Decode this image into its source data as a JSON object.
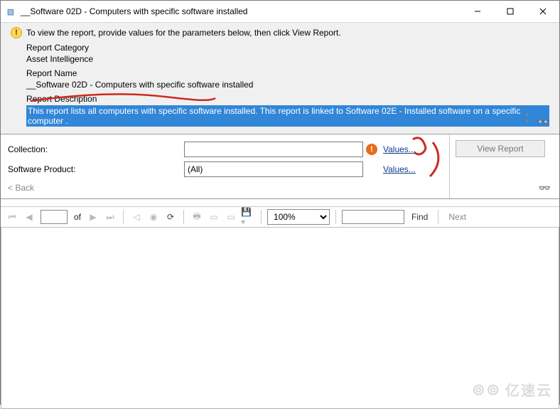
{
  "window": {
    "title": "__Software 02D - Computers with specific software installed"
  },
  "info": {
    "hint": "To view the report, provide values for the parameters below, then click View Report.",
    "category_label": "Report Category",
    "category_value": "Asset Intelligence",
    "name_label": "Report Name",
    "name_value": "__Software 02D - Computers with specific software installed",
    "desc_label": "Report Description",
    "desc_value": "This report lists all computers with specific software installed. This report is linked to Software 02E - Installed software on a specific computer ."
  },
  "params": {
    "collection_label": "Collection:",
    "collection_value": "",
    "product_label": "Software Product:",
    "product_value": "(All)",
    "values_label": "Values...",
    "back_label": "< Back",
    "view_report_label": "View Report"
  },
  "toolbar": {
    "of_label": "of",
    "page_value": "",
    "zoom_value": "100%",
    "find_placeholder": "",
    "find_label": "Find",
    "next_label": "Next"
  },
  "watermark": "亿速云"
}
